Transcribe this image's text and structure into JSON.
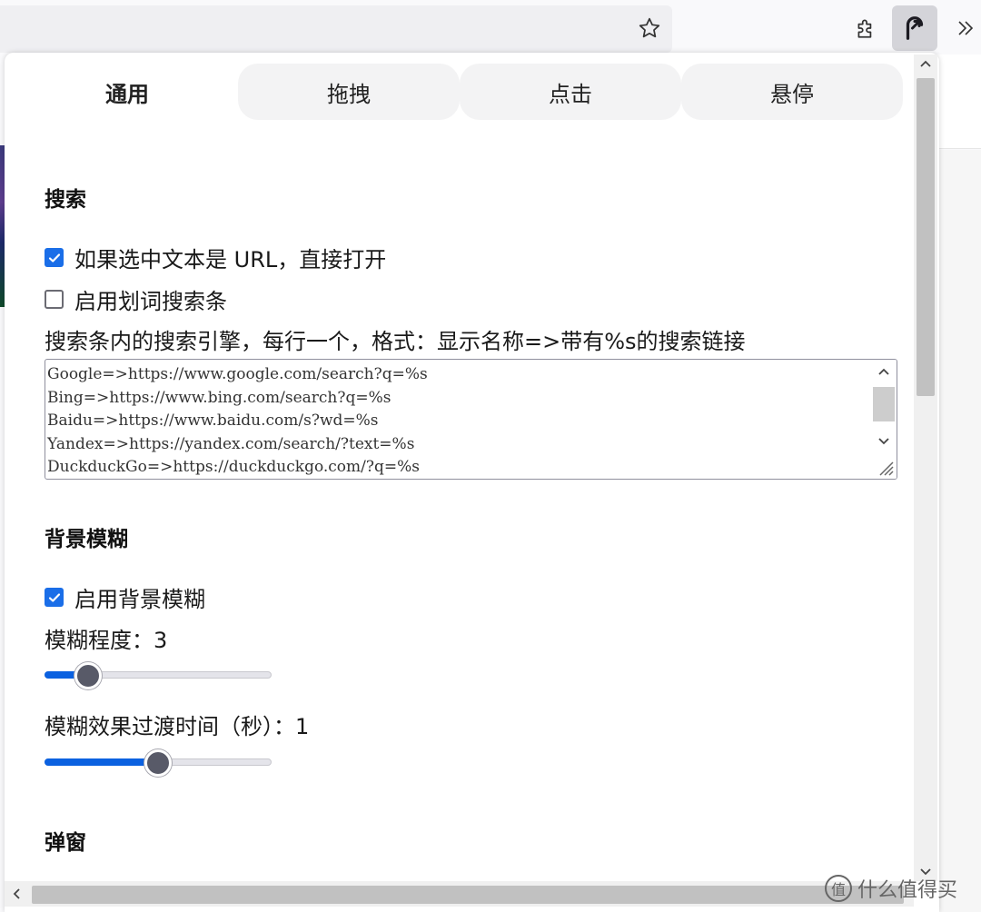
{
  "toolbar": {
    "bookmark_icon": "star-icon",
    "extensions_icon": "puzzle-icon",
    "active_extension_icon": "extension-logo-icon",
    "overflow_icon": "double-chevron-icon"
  },
  "tabs": [
    {
      "label": "通用",
      "active": true
    },
    {
      "label": "拖拽",
      "active": false
    },
    {
      "label": "点击",
      "active": false
    },
    {
      "label": "悬停",
      "active": false
    }
  ],
  "search": {
    "title": "搜索",
    "open_url_label": "如果选中文本是 URL，直接打开",
    "open_url_checked": true,
    "enable_bar_label": "启用划词搜索条",
    "enable_bar_checked": false,
    "engines_label": "搜索条内的搜索引擎，每行一个，格式：显示名称=>带有%s的搜索链接",
    "engines_value": "Google=>https://www.google.com/search?q=%s\nBing=>https://www.bing.com/search?q=%s\nBaidu=>https://www.baidu.com/s?wd=%s\nYandex=>https://yandex.com/search/?text=%s\nDuckduckGo=>https://duckduckgo.com/?q=%s"
  },
  "blur": {
    "title": "背景模糊",
    "enable_label": "启用背景模糊",
    "enable_checked": true,
    "level_label": "模糊程度：",
    "level_value": "3",
    "level_slider_fraction": 0.19,
    "transition_label": "模糊效果过渡时间（秒）：",
    "transition_value": "1",
    "transition_slider_fraction": 0.5
  },
  "popup_section": {
    "title": "弹窗"
  },
  "watermark": {
    "icon_text": "值",
    "text": "什么值得买"
  },
  "colors": {
    "accent": "#1a6ee8",
    "slider_fill": "#0b61e0",
    "knob": "#585a68"
  }
}
